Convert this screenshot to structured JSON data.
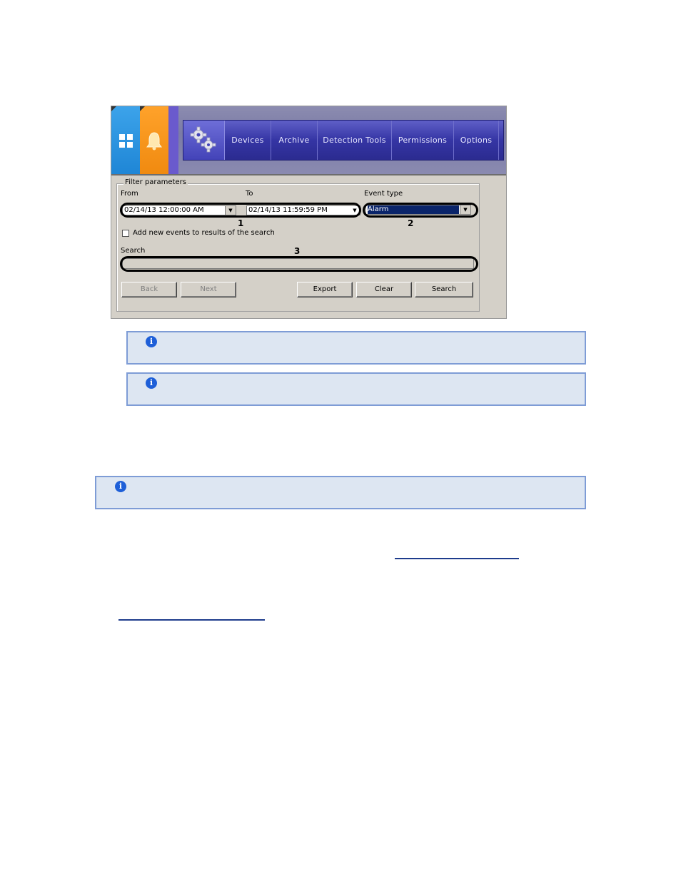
{
  "toolbar": {
    "nav": [
      "Devices",
      "Archive",
      "Detection Tools",
      "Permissions",
      "Options"
    ]
  },
  "filter": {
    "legend": "Filter parameters",
    "from_label": "From",
    "to_label": "To",
    "event_type_label": "Event type",
    "from_value": "02/14/13 12:00:00 AM",
    "to_value": "02/14/13 11:59:59 PM",
    "event_type_value": "Alarm",
    "add_new_events_label": "Add new events to results of the search",
    "search_label": "Search",
    "search_value": ""
  },
  "buttons": {
    "back": "Back",
    "next": "Next",
    "export": "Export",
    "clear": "Clear",
    "search": "Search"
  },
  "callouts": [
    "1",
    "2",
    "3"
  ],
  "colors": {
    "note_bg": "#dde6f2",
    "note_border": "#7e9cd6",
    "info_icon": "#1e5fd8",
    "nav_bar": "#3535a4",
    "tab_blue": "#1f86d6",
    "tab_orange": "#f08a10",
    "selection": "#0a246a"
  },
  "icons": {
    "windows_tab": "windows-icon",
    "alarm_tab": "bell-icon",
    "settings": "gears-icon",
    "note": "info-icon"
  }
}
